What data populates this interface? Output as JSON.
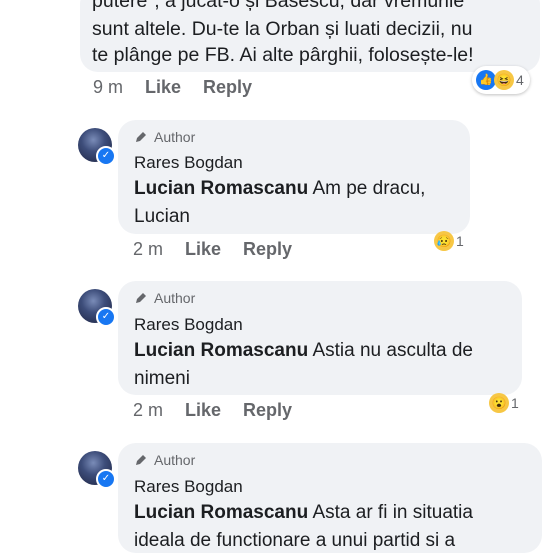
{
  "first_comment": {
    "lines": [
      "putere\", a jucat-o și Basescu, dar vremurile",
      "sunt altele. Du-te la Orban și luati decizii, nu",
      "te plânge pe FB. Ai alte pârghii, folosește-le!"
    ],
    "time": "9 m",
    "like": "Like",
    "reply": "Reply",
    "reaction_count": "4",
    "reaction_icons": [
      "like-icon",
      "haha-icon"
    ]
  },
  "replies": [
    {
      "badge": "Author",
      "name": "Rares Bogdan",
      "mention": "Lucian Romascanu",
      "text_line1": " Am pe dracu,",
      "text_line2": "Lucian",
      "time": "2 m",
      "like": "Like",
      "reply": "Reply",
      "reaction_count": "1",
      "reaction_icon": "sad-icon"
    },
    {
      "badge": "Author",
      "name": "Rares Bogdan",
      "mention": "Lucian Romascanu",
      "text_line1": " Astia nu asculta de",
      "text_line2": "nimeni",
      "time": "2 m",
      "like": "Like",
      "reply": "Reply",
      "reaction_count": "1",
      "reaction_icon": "wow-icon"
    },
    {
      "badge": "Author",
      "name": "Rares Bogdan",
      "mention": "Lucian Romascanu",
      "text_line1": " Asta ar fi in situatia",
      "text_line2": "ideala de functionare a unui partid si a"
    }
  ]
}
